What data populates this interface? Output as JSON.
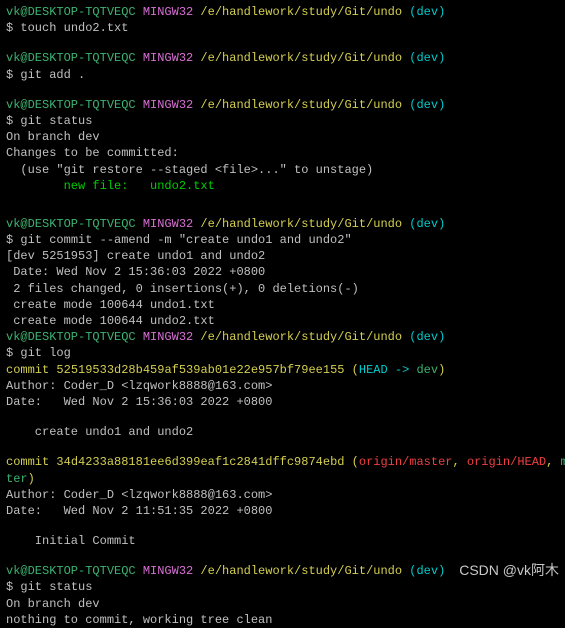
{
  "prompt": {
    "user": "vk@DESKTOP-TQTVEQC",
    "env": " MINGW32",
    "path": " /e/handlework/study/Git/undo",
    "branch_open": " (",
    "branch": "dev",
    "branch_close": ")",
    "dollar": "$ "
  },
  "blocks": [
    {
      "cmd": "touch undo2.txt",
      "out": []
    },
    {
      "cmd": "git add .",
      "out": []
    },
    {
      "cmd": "git status",
      "out": [
        {
          "t": "On branch dev"
        },
        {
          "t": "Changes to be committed:"
        },
        {
          "t": "  (use \"git restore --staged <file>...\" to unstage)"
        },
        {
          "t": "        new file:   undo2.txt",
          "cls": "staged"
        }
      ]
    },
    {
      "cmd": "git commit --amend -m \"create undo1 and undo2\"",
      "out": [
        {
          "t": "[dev 5251953] create undo1 and undo2"
        },
        {
          "t": " Date: Wed Nov 2 15:36:03 2022 +0800"
        },
        {
          "t": " 2 files changed, 0 insertions(+), 0 deletions(-)"
        },
        {
          "t": " create mode 100644 undo1.txt"
        },
        {
          "t": " create mode 100644 undo2.txt"
        }
      ],
      "nogap": true
    },
    {
      "cmd": "git log",
      "out": []
    }
  ],
  "log": {
    "c1": {
      "prefix": "commit ",
      "sha": "52519533d28b459af539ab01e22e957bf79ee155",
      "open": " (",
      "head": "HEAD -> ",
      "branch": "dev",
      "close": ")",
      "author": "Author: Coder_D <lzqwork8888@163.com>",
      "date": "Date:   Wed Nov 2 15:36:03 2022 +0800",
      "msg": "    create undo1 and undo2"
    },
    "c2": {
      "prefix": "commit ",
      "sha": "34d4233a88181ee6d399eaf1c2841dffc9874ebd",
      "open": " (",
      "r1": "origin/master",
      "sep1": ", ",
      "r2": "origin/HEAD",
      "sep2": ", ",
      "r3l1": "mas",
      "r3l2": "ter",
      "close": ")",
      "author": "Author: Coder_D <lzqwork8888@163.com>",
      "date": "Date:   Wed Nov 2 11:51:35 2022 +0800",
      "msg": "    Initial Commit"
    }
  },
  "final": {
    "cmd": "git status",
    "out": [
      {
        "t": "On branch dev"
      },
      {
        "t": "nothing to commit, working tree clean"
      }
    ]
  },
  "watermark": "CSDN @vk阿木"
}
